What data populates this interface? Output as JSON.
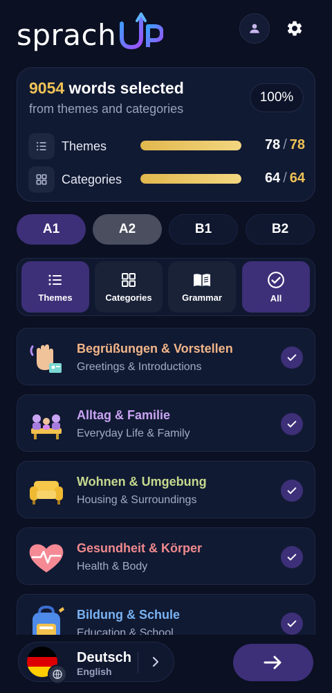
{
  "app": {
    "logo_text": "sprach",
    "logo_suffix": "UP"
  },
  "header": {
    "profile_icon": "person-icon",
    "settings_icon": "gear-icon"
  },
  "summary": {
    "word_count": "9054",
    "title_rest": " words selected",
    "subtitle": "from themes and categories",
    "percent": "100%",
    "themes": {
      "label": "Themes",
      "selected": "78",
      "sep": "/",
      "total": "78",
      "fill": 1.0
    },
    "categories": {
      "label": "Categories",
      "selected": "64",
      "sep": "/",
      "total": "64",
      "fill": 1.0
    }
  },
  "levels": [
    "A1",
    "A2",
    "B1",
    "B2"
  ],
  "tabs": [
    {
      "label": "Themes",
      "icon": "list-icon"
    },
    {
      "label": "Categories",
      "icon": "grid-icon"
    },
    {
      "label": "Grammar",
      "icon": "book-icon"
    },
    {
      "label": "All",
      "icon": "check-circle-icon"
    }
  ],
  "themes": [
    {
      "title": "Begrüßungen & Vorstellen",
      "subtitle": "Greetings & Introductions",
      "color": "#f3b688",
      "icon": "waving-hand-icon",
      "checked": true
    },
    {
      "title": "Alltag & Familie",
      "subtitle": "Everyday Life & Family",
      "color": "#c9a4f2",
      "icon": "family-icon",
      "checked": true
    },
    {
      "title": "Wohnen & Umgebung",
      "subtitle": "Housing & Surroundings",
      "color": "#c5d98e",
      "icon": "sofa-icon",
      "checked": true
    },
    {
      "title": "Gesundheit & Körper",
      "subtitle": "Health & Body",
      "color": "#f08a8e",
      "icon": "heart-icon",
      "checked": true
    },
    {
      "title": "Bildung & Schule",
      "subtitle": "Education & School",
      "color": "#79b3f3",
      "icon": "backpack-icon",
      "checked": true
    }
  ],
  "footer": {
    "language": "Deutsch",
    "sub_language": "English",
    "flag_colors": [
      "#000000",
      "#dd0000",
      "#ffce00"
    ]
  },
  "colors": {
    "accent": "#3d2f78",
    "gold": "#efc256",
    "background": "#0b1022"
  }
}
